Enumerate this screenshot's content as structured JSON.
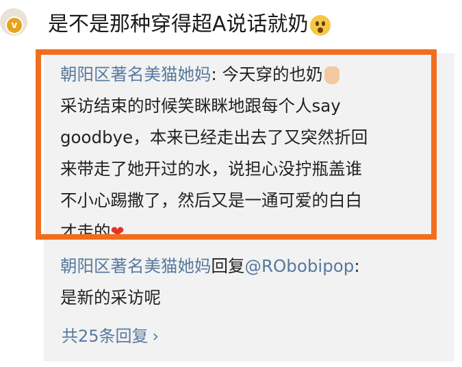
{
  "comment": {
    "text": "是不是那种穿得超A说话就奶",
    "emoji_icon": "shocked-face-emoji"
  },
  "reply1": {
    "author": "朝阳区著名美猫她妈",
    "separator": ":",
    "line1": " 今天穿的也奶",
    "hand_icon": "victory-hand-emoji",
    "line2": "采访结束的时候笑眯眯地跟每个人say",
    "line3": "goodbye，本来已经走出去了又突然折回",
    "line4": "来带走了她开过的水，说担心没拧瓶盖谁",
    "line5": "不小心踢撒了，然后又是一通可爱的白白",
    "line6": "才走的",
    "heart_icon": "red-heart-emoji"
  },
  "reply2": {
    "author": "朝阳区著名美猫她妈",
    "reply_word": "回复",
    "mention": "@RObobipop",
    "separator": ":",
    "line2": "是新的采访呢"
  },
  "more_replies": {
    "label": "共25条回复",
    "chevron": "›"
  },
  "colors": {
    "highlight_border": "#f26d1e",
    "name_link": "#57799f",
    "panel_bg": "#f2f2f2",
    "badge": "#e8a21a"
  }
}
